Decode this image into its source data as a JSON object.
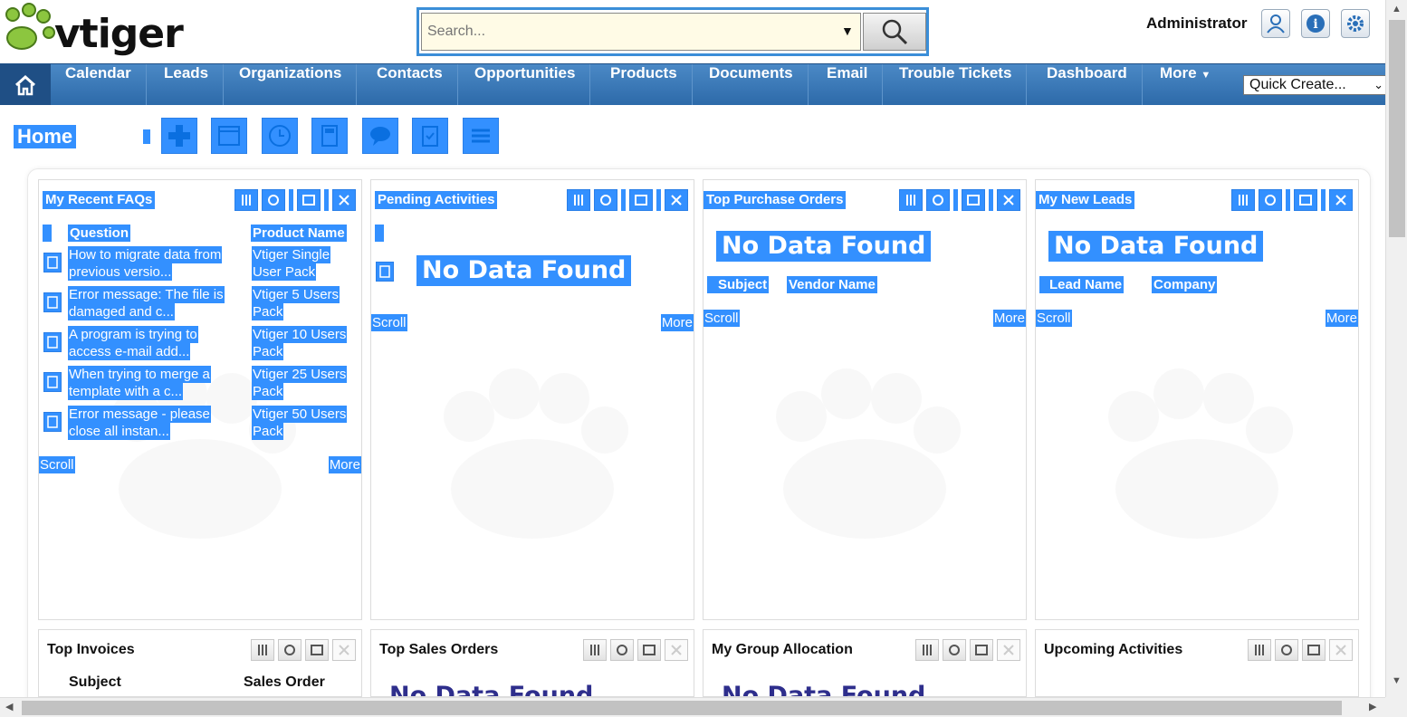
{
  "header": {
    "logo_text": "vtiger",
    "search_placeholder": "Search...",
    "user_name": "Administrator",
    "icons": [
      "user-icon",
      "info-icon",
      "gear-icon"
    ]
  },
  "nav": {
    "items": [
      "Calendar",
      "Leads",
      "Organizations",
      "Contacts",
      "Opportunities",
      "Products",
      "Documents",
      "Email",
      "Trouble Tickets",
      "Dashboard",
      "More"
    ],
    "quick_create": "Quick Create..."
  },
  "home": {
    "title": "Home"
  },
  "widgets": {
    "faqs": {
      "title": "My Recent FAQs",
      "col_question": "Question",
      "col_product": "Product Name",
      "rows": [
        {
          "q1": "How to migrate data from",
          "q2": "previous versio...",
          "p1": "Vtiger Single",
          "p2": "User Pack"
        },
        {
          "q1": "Error message: The file is",
          "q2": "damaged and c...",
          "p1": "Vtiger 5 Users",
          "p2": "Pack"
        },
        {
          "q1": "A program is trying to",
          "q2": "access e-mail add...",
          "p1": "Vtiger 10 Users",
          "p2": "Pack"
        },
        {
          "q1": "When trying to merge a",
          "q2": "template with a c...",
          "p1": "Vtiger 25 Users",
          "p2": "Pack"
        },
        {
          "q1": "Error message - please",
          "q2": "close all instan...",
          "p1": "Vtiger 50 Users",
          "p2": "Pack"
        }
      ],
      "scroll": "Scroll",
      "more": "More"
    },
    "pending": {
      "title": "Pending Activities",
      "no_data": "No Data Found",
      "scroll": "Scroll",
      "more": "More"
    },
    "purchase": {
      "title": "Top Purchase Orders",
      "no_data": "No Data Found",
      "col1": "Subject",
      "col2": "Vendor Name",
      "scroll": "Scroll",
      "more": "More"
    },
    "leads": {
      "title": "My New Leads",
      "no_data": "No Data Found",
      "col1": "Lead Name",
      "col2": "Company",
      "scroll": "Scroll",
      "more": "More"
    },
    "invoices": {
      "title": "Top Invoices",
      "col1": "Subject",
      "col2": "Sales Order"
    },
    "sales": {
      "title": "Top Sales Orders",
      "no_data": "No Data Found"
    },
    "group": {
      "title": "My Group Allocation",
      "no_data": "No Data Found"
    },
    "upcoming": {
      "title": "Upcoming Activities"
    }
  }
}
